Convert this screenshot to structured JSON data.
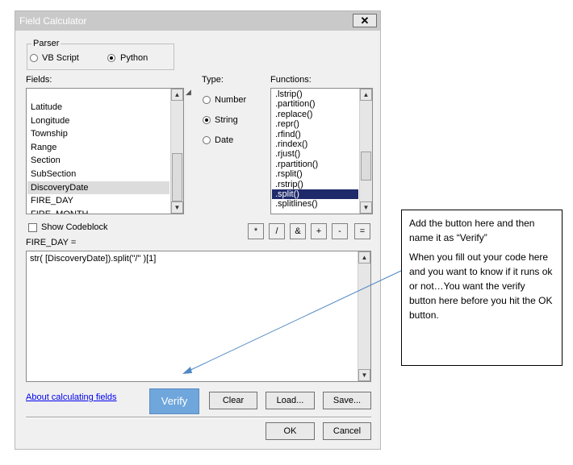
{
  "dialog": {
    "title": "Field Calculator",
    "close_symbol": "✕"
  },
  "parser": {
    "label": "Parser",
    "options": [
      {
        "label": "VB Script",
        "selected": false
      },
      {
        "label": "Python",
        "selected": true
      }
    ]
  },
  "fields": {
    "label": "Fields:",
    "items": [
      "Latitude",
      "Longitude",
      "Township",
      "Range",
      "Section",
      "SubSection",
      "DiscoveryDate",
      "FIRE_DAY",
      "FIRE_MONTH"
    ],
    "selected": "DiscoveryDate"
  },
  "type": {
    "label": "Type:",
    "options": [
      {
        "label": "Number",
        "selected": false
      },
      {
        "label": "String",
        "selected": true
      },
      {
        "label": "Date",
        "selected": false
      }
    ]
  },
  "functions": {
    "label": "Functions:",
    "items": [
      ".lstrip()",
      ".partition()",
      ".replace()",
      ".repr()",
      ".rfind()",
      ".rindex()",
      ".rjust()",
      ".rpartition()",
      ".rsplit()",
      ".rstrip()",
      ".split()",
      ".splitlines()"
    ],
    "selected": ".split()"
  },
  "codeblock": {
    "label": "Show Codeblock",
    "checked": false
  },
  "operators": [
    "*",
    "/",
    "&",
    "+",
    "-",
    "="
  ],
  "expression": {
    "label": "FIRE_DAY =",
    "value": "str( [DiscoveryDate]).split(\"/\" )[1]"
  },
  "footer": {
    "help_link": "About calculating fields",
    "verify": "Verify",
    "clear": "Clear",
    "load": "Load...",
    "save": "Save...",
    "ok": "OK",
    "cancel": "Cancel"
  },
  "annotation": {
    "paragraph1": "Add the button here and then name it as “Verify”",
    "paragraph2": "When you fill out your code here and you want to know if it runs ok or not…You want the verify button here before you hit the OK button.",
    "arrow_color": "#4f87c5"
  },
  "colors": {
    "selection": "#1f2a6b",
    "verify_bg": "#6fa6dc",
    "titlebar": "#c9c9c9",
    "dialog_bg": "#f0f0f0"
  }
}
